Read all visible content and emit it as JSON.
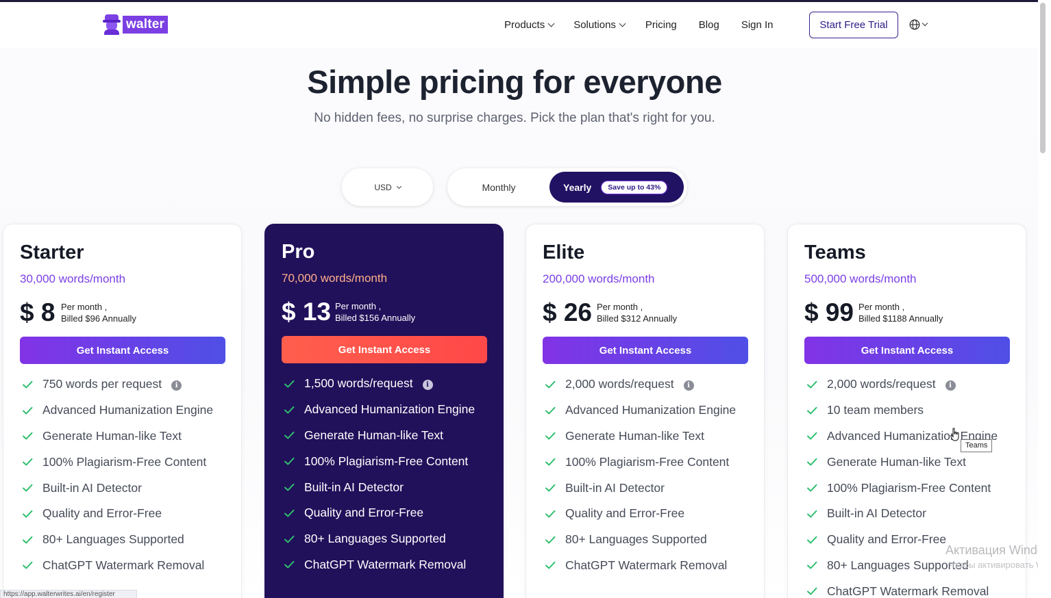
{
  "brand": {
    "name": "walter",
    "accent": "#7b3fe4",
    "dark": "#21105a"
  },
  "nav": {
    "items": [
      {
        "label": "Products",
        "dropdown": true
      },
      {
        "label": "Solutions",
        "dropdown": true
      },
      {
        "label": "Pricing",
        "dropdown": false
      },
      {
        "label": "Blog",
        "dropdown": false
      },
      {
        "label": "Sign In",
        "dropdown": false
      }
    ],
    "cta": "Start Free Trial",
    "language_icon": "globe-icon"
  },
  "hero": {
    "title": "Simple pricing for everyone",
    "subtitle": "No hidden fees, no surprise charges. Pick the plan that's right for you."
  },
  "currency": {
    "selected": "USD"
  },
  "billing": {
    "monthly": "Monthly",
    "yearly": "Yearly",
    "selected": "Yearly",
    "badge": "Save up to 43%"
  },
  "plans": [
    {
      "name": "Starter",
      "words": "30,000 words/month",
      "price": "$ 8",
      "period": "Per month ,",
      "billed": "Billed $96 Annually",
      "cta": "Get Instant Access",
      "features": [
        "750 words per request",
        "Advanced Humanization Engine",
        "Generate Human-like Text",
        "100% Plagiarism-Free Content",
        "Built-in AI Detector",
        "Quality and Error-Free",
        "80+ Languages Supported",
        "ChatGPT Watermark Removal"
      ]
    },
    {
      "name": "Pro",
      "words": "70,000 words/month",
      "price": "$ 13",
      "period": "Per month ,",
      "billed": "Billed $156 Annually",
      "cta": "Get Instant Access",
      "features": [
        "1,500 words/request",
        "Advanced Humanization Engine",
        "Generate Human-like Text",
        "100% Plagiarism-Free Content",
        "Built-in AI Detector",
        "Quality and Error-Free",
        "80+ Languages Supported",
        "ChatGPT Watermark Removal"
      ]
    },
    {
      "name": "Elite",
      "words": "200,000 words/month",
      "price": "$ 26",
      "period": "Per month ,",
      "billed": "Billed $312 Annually",
      "cta": "Get Instant Access",
      "features": [
        "2,000 words/request",
        "Advanced Humanization Engine",
        "Generate Human-like Text",
        "100% Plagiarism-Free Content",
        "Built-in AI Detector",
        "Quality and Error-Free",
        "80+ Languages Supported",
        "ChatGPT Watermark Removal"
      ]
    },
    {
      "name": "Teams",
      "words": "500,000 words/month",
      "price": "$ 99",
      "period": "Per month ,",
      "billed": "Billed $1188 Annually",
      "cta": "Get Instant Access",
      "features": [
        "2,000 words/request",
        "10 team members",
        "Advanced Humanization Engine",
        "Generate Human-like Text",
        "100% Plagiarism-Free Content",
        "Built-in AI Detector",
        "Quality and Error-Free",
        "80+ Languages Supported",
        "ChatGPT Watermark Removal"
      ]
    }
  ],
  "tooltip": "Teams",
  "watermark": {
    "line1": "Активация Windo",
    "line2": "Чтобы активировать W"
  },
  "status_url": "https://app.walterwrites.ai/en/register"
}
